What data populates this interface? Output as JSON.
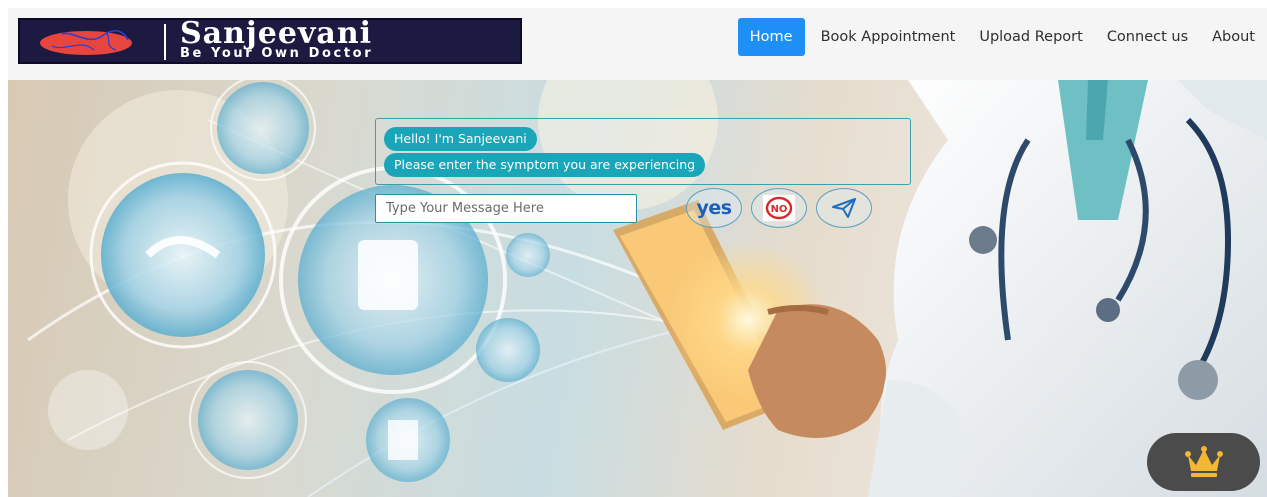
{
  "brand": {
    "title": "Sanjeevani",
    "tagline": "Be Your Own Doctor",
    "logo_icon": "kidney-logo-icon"
  },
  "nav": {
    "items": [
      {
        "label": "Home",
        "active": true
      },
      {
        "label": "Book Appointment",
        "active": false
      },
      {
        "label": "Upload Report",
        "active": false
      },
      {
        "label": "Connect us",
        "active": false
      },
      {
        "label": "About",
        "active": false
      }
    ]
  },
  "chat": {
    "messages": [
      "Hello! I'm Sanjeevani",
      "Please enter the symptom you are experiencing"
    ],
    "input_placeholder": "Type Your Message Here",
    "yes_label": "yes",
    "no_label": "NO",
    "send_icon": "send-icon"
  },
  "widget": {
    "icon": "crown-icon"
  },
  "colors": {
    "nav_active": "#1e90f5",
    "bubble": "#1aa5b8",
    "brand_bg": "#1d1a42",
    "crown": "#f5b731"
  }
}
